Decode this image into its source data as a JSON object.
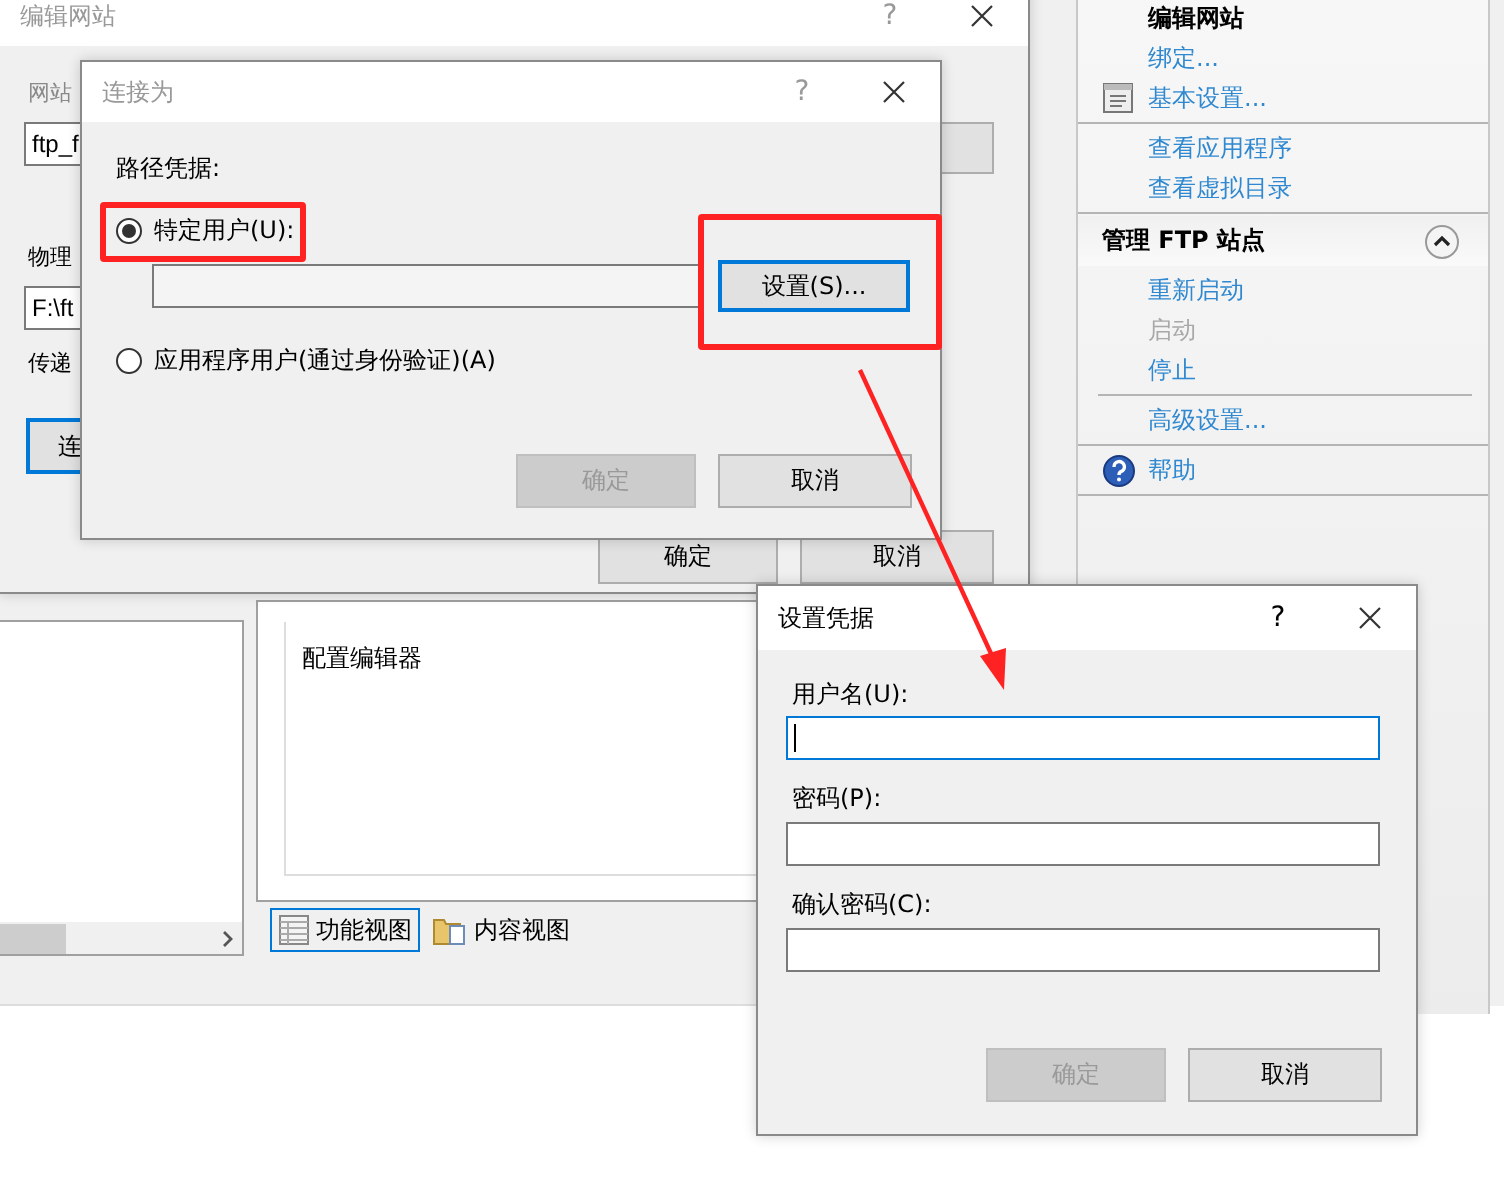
{
  "manager": {
    "content_items": [
      "配置编辑器"
    ],
    "view_tabs": [
      {
        "label": "功能视图",
        "selected": true,
        "kind": "features"
      },
      {
        "label": "内容视图",
        "selected": false,
        "kind": "content"
      }
    ],
    "actions": {
      "groups": [
        {
          "items": [
            {
              "label": "编辑网站",
              "kind": "title",
              "disabled": false
            },
            {
              "label": "绑定...",
              "kind": "link",
              "disabled": false
            },
            {
              "label": "基本设置...",
              "kind": "settings",
              "disabled": false
            }
          ]
        },
        {
          "items": [
            {
              "label": "查看应用程序",
              "kind": "link",
              "disabled": false
            },
            {
              "label": "查看虚拟目录",
              "kind": "link",
              "disabled": false
            }
          ]
        }
      ],
      "section": {
        "title": "管理 FTP 站点",
        "expanded": true,
        "groups": [
          {
            "items": [
              {
                "label": "重新启动",
                "kind": "link",
                "disabled": false
              },
              {
                "label": "启动",
                "kind": "link",
                "disabled": true
              },
              {
                "label": "停止",
                "kind": "link",
                "disabled": false
              }
            ]
          },
          {
            "items": [
              {
                "label": "高级设置...",
                "kind": "link",
                "disabled": false
              }
            ]
          },
          {
            "items": [
              {
                "label": "帮助",
                "kind": "help",
                "disabled": false
              }
            ]
          }
        ]
      }
    }
  },
  "edit_site_dialog": {
    "title": "编辑网站",
    "active": false,
    "help": "?",
    "site_label": "网站",
    "site_value": "ftp_f",
    "path_label": "物理",
    "path_value": "F:\\ft",
    "pass_label": "传递",
    "connect_button": "连",
    "ok_button": "确定",
    "cancel_button": "取消"
  },
  "connect_as_dialog": {
    "title": "连接为",
    "active": false,
    "help": "?",
    "group_label": "路径凭据:",
    "options": [
      {
        "label": "特定用户(U):",
        "selected": true
      },
      {
        "label": "应用程序用户(通过身份验证)(A)",
        "selected": false
      }
    ],
    "set_button": "设置(S)...",
    "ok_button": {
      "label": "确定",
      "disabled": true
    },
    "cancel_button": {
      "label": "取消",
      "disabled": false
    }
  },
  "credentials_dialog": {
    "title": "设置凭据",
    "active": true,
    "help": "?",
    "fields": [
      {
        "label": "用户名(U):",
        "focused": true
      },
      {
        "label": "密码(P):",
        "focused": false
      },
      {
        "label": "确认密码(C):",
        "focused": false
      }
    ],
    "ok_button": {
      "label": "确定",
      "disabled": true
    },
    "cancel_button": {
      "label": "取消",
      "disabled": false
    }
  }
}
